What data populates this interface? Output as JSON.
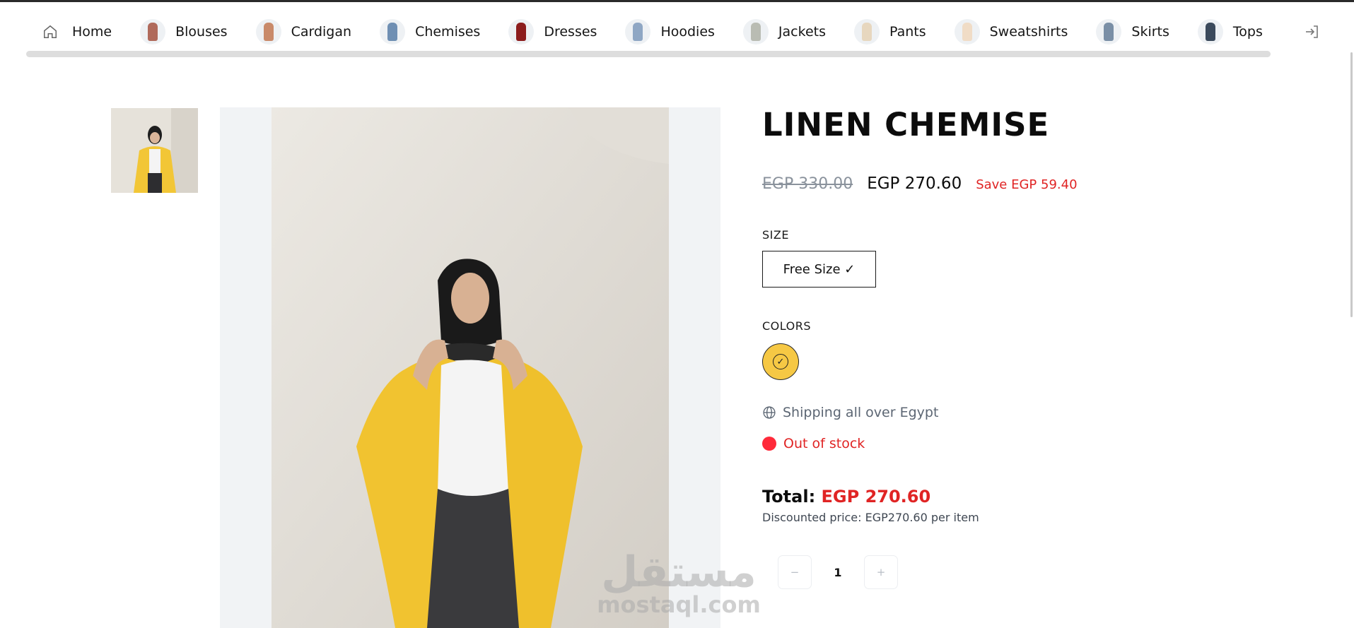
{
  "nav": {
    "home_label": "Home",
    "items": [
      {
        "label": "Blouses",
        "icon": "blouse-thumbnail",
        "color": "#b06a5b"
      },
      {
        "label": "Cardigan",
        "icon": "cardigan-thumbnail",
        "color": "#c98a6a"
      },
      {
        "label": "Chemises",
        "icon": "chemise-thumbnail",
        "color": "#6f8fb3"
      },
      {
        "label": "Dresses",
        "icon": "dress-thumbnail",
        "color": "#8c1d1d"
      },
      {
        "label": "Hoodies",
        "icon": "hoodie-thumbnail",
        "color": "#8fa7c4"
      },
      {
        "label": "Jackets",
        "icon": "jacket-thumbnail",
        "color": "#b9bcb3"
      },
      {
        "label": "Pants",
        "icon": "pants-thumbnail",
        "color": "#e7d7bf"
      },
      {
        "label": "Sweatshirts",
        "icon": "sweatshirt-thumbnail",
        "color": "#f0dcc6"
      },
      {
        "label": "Skirts",
        "icon": "skirt-thumbnail",
        "color": "#7a8fa6"
      },
      {
        "label": "Tops",
        "icon": "top-thumbnail",
        "color": "#3b4a5c"
      }
    ],
    "login_icon": "login-icon"
  },
  "product": {
    "title": "LINEN CHEMISE",
    "old_price": "EGP 330.00",
    "new_price": "EGP 270.60",
    "save_text": "Save EGP 59.40",
    "size_label": "SIZE",
    "size_option": "Free Size ✓",
    "colors_label": "COLORS",
    "selected_color": "#f6c844",
    "color_check": "✓",
    "shipping_text": "Shipping all over Egypt",
    "stock_text": "Out of stock",
    "total_label": "Total:",
    "total_value": "EGP 270.60",
    "discount_text": "Discounted price: EGP270.60 per item",
    "quantity": "1",
    "minus": "−",
    "plus": "+"
  },
  "watermark": {
    "arabic": "مستقل",
    "latin": "mostaql.com"
  },
  "colors": {
    "accent_red": "#e02424",
    "muted_grey": "#8a929c",
    "swatch_yellow": "#f6c844"
  }
}
